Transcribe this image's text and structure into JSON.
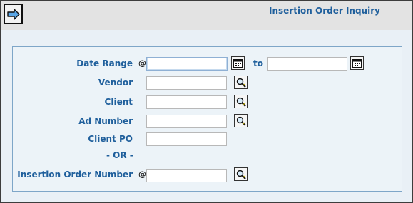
{
  "header": {
    "title": "Insertion Order Inquiry",
    "go_icon": "arrow-right-icon"
  },
  "form": {
    "date_range_label": "Date Range",
    "date_to_label": "to",
    "vendor_label": "Vendor",
    "client_label": "Client",
    "ad_number_label": "Ad Number",
    "client_po_label": "Client PO",
    "or_label": "- OR -",
    "insertion_order_number_label": "Insertion Order Number",
    "required_marker": "@",
    "date_from_value": "",
    "date_to_value": "",
    "vendor_value": "",
    "client_value": "",
    "ad_number_value": "",
    "client_po_value": "",
    "insertion_order_number_value": "",
    "calendar_icon": "calendar-icon",
    "lookup_icon": "magnifier-icon"
  },
  "colors": {
    "label": "#1f5f9c",
    "background": "#e9f0f6",
    "header_bg": "#e3e3e3",
    "panel_border": "#7ea6c8"
  }
}
